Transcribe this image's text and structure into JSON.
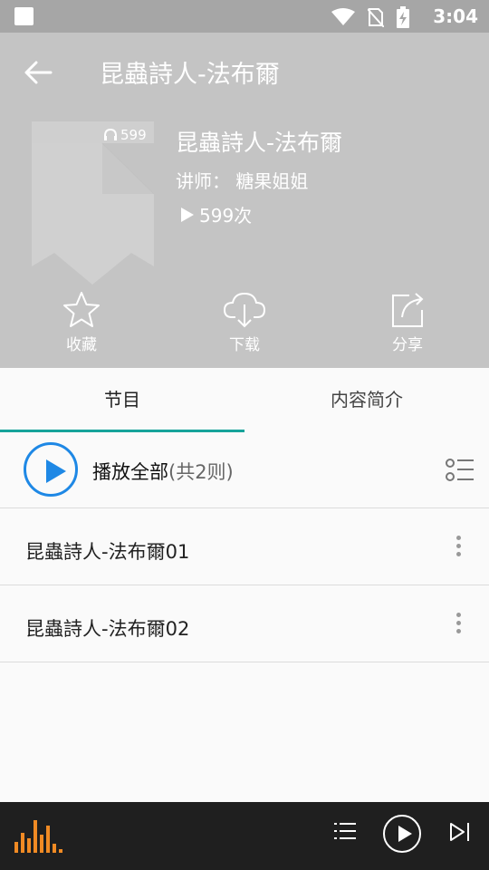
{
  "status_bar": {
    "time": "3:04"
  },
  "header": {
    "title": "昆蟲詩人-法布爾"
  },
  "album": {
    "listen_count": "599",
    "title": "昆蟲詩人-法布爾",
    "teacher_label": "讲师：",
    "teacher_name": "糖果姐姐",
    "play_count": "599次"
  },
  "actions": [
    {
      "label": "收藏",
      "icon": "star-icon"
    },
    {
      "label": "下载",
      "icon": "cloud-download-icon"
    },
    {
      "label": "分享",
      "icon": "share-icon"
    }
  ],
  "tabs": [
    {
      "label": "节目",
      "active": true
    },
    {
      "label": "内容简介",
      "active": false
    }
  ],
  "play_all": {
    "label": "播放全部",
    "count": "(共2则)"
  },
  "episodes": [
    {
      "title": "昆蟲詩人-法布爾01"
    },
    {
      "title": "昆蟲詩人-法布爾02"
    }
  ],
  "colors": {
    "accent": "#16a39a",
    "play_blue": "#1e88e5",
    "eq_orange": "#f08a24"
  }
}
